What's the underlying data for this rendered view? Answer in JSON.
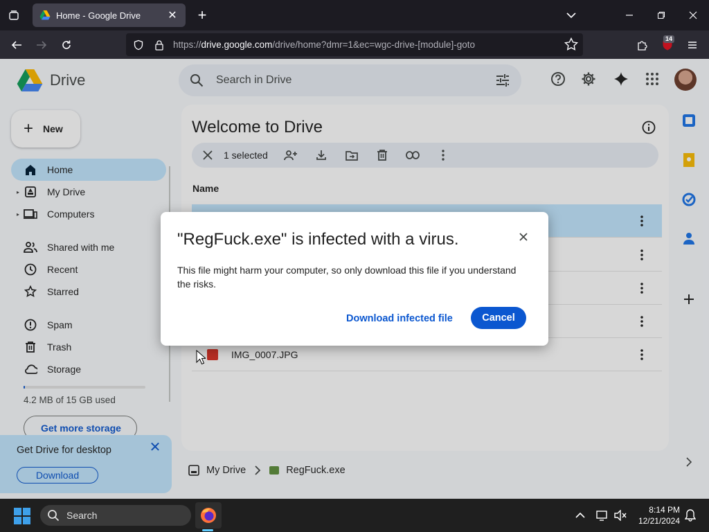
{
  "browser": {
    "tab_title": "Home - Google Drive",
    "url_prefix": "https://",
    "url_domain": "drive.google.com",
    "url_rest": "/drive/home?dmr=1&ec=wgc-drive-[module]-goto",
    "extension_badge": "14"
  },
  "drive": {
    "logo_text": "Drive",
    "search_placeholder": "Search in Drive",
    "new_label": "New",
    "sidebar": [
      {
        "label": "Home",
        "icon": "home-icon"
      },
      {
        "label": "My Drive",
        "icon": "my-drive-icon"
      },
      {
        "label": "Computers",
        "icon": "computer-icon"
      },
      {
        "label": "Shared with me",
        "icon": "people-icon"
      },
      {
        "label": "Recent",
        "icon": "clock-icon"
      },
      {
        "label": "Starred",
        "icon": "star-icon"
      },
      {
        "label": "Spam",
        "icon": "spam-icon"
      },
      {
        "label": "Trash",
        "icon": "trash-icon"
      },
      {
        "label": "Storage",
        "icon": "cloud-icon"
      }
    ],
    "storage_text": "4.2 MB of 15 GB used",
    "storage_fraction": 0.0003,
    "get_storage_label": "Get more storage",
    "promo": {
      "title": "Get Drive for desktop",
      "button": "Download"
    },
    "main_title": "Welcome to Drive",
    "selection_count": "1 selected",
    "column_name": "Name",
    "visible_file": "IMG_0007.JPG",
    "breadcrumb": {
      "root": "My Drive",
      "current": "RegFuck.exe"
    }
  },
  "dialog": {
    "title": "\"RegFuck.exe\" is infected with a virus.",
    "body": "This file might harm your computer, so only download this file if you understand the risks.",
    "download_label": "Download infected file",
    "cancel_label": "Cancel"
  },
  "taskbar": {
    "search_label": "Search",
    "time": "8:14 PM",
    "date": "12/21/2024"
  },
  "colors": {
    "accent": "#0b57d0",
    "selected": "#c2e7ff"
  }
}
